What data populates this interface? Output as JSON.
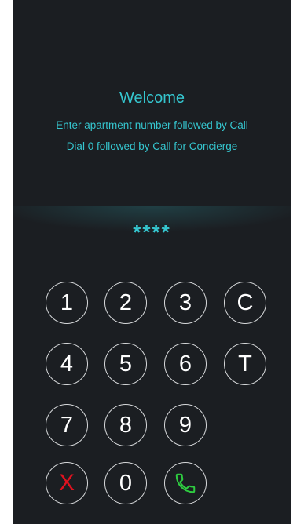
{
  "header": {
    "title": "Welcome",
    "line1": "Enter apartment number followed by Call",
    "line2": "Dial 0 followed by Call for Concierge"
  },
  "display": {
    "code": "****"
  },
  "keypad": {
    "k1": "1",
    "k2": "2",
    "k3": "3",
    "clear": "C",
    "k4": "4",
    "k5": "5",
    "k6": "6",
    "t": "T",
    "k7": "7",
    "k8": "8",
    "k9": "9",
    "cancel": "X",
    "k0": "0",
    "call_icon": "phone-icon"
  },
  "colors": {
    "accent": "#35c6cf",
    "background": "#1b1e22",
    "cancel": "#e0121f",
    "call": "#2ecc40"
  }
}
